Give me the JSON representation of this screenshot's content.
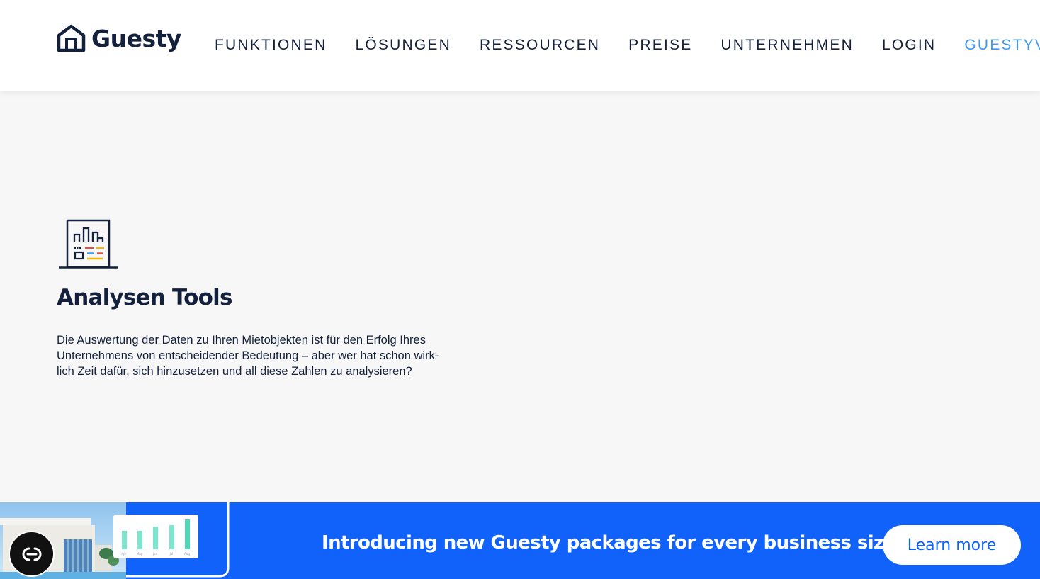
{
  "header": {
    "brand": "Guesty",
    "nav": [
      {
        "label": "FUNKTIONEN"
      },
      {
        "label": "LÖSUNGEN"
      },
      {
        "label": "RESSOURCEN"
      },
      {
        "label": "PREISE"
      },
      {
        "label": "UNTERNEHMEN"
      },
      {
        "label": "LOGIN"
      },
      {
        "label": "GUESTYVAL",
        "accent": "#3f99f1"
      }
    ]
  },
  "feature": {
    "icon": "analytics-dashboard-icon",
    "title": "Analysen Tools",
    "description_lines": [
      "Die Auswertung der Daten zu Ihren Mietobjekten ist für den Erfolg Ihres",
      "Unternehmens von entscheidender Bedeutung – aber wer hat schon wirk-",
      "lich Zeit dafür, sich hinzusetzen und all diese Zahlen zu analysieren?"
    ]
  },
  "banner": {
    "text": "Introducing new Guesty packages for every business size!",
    "button_label": "Learn more",
    "background": "#1062fb",
    "chart_months": [
      "Apr",
      "May",
      "Jun",
      "Jul",
      "Aug"
    ]
  },
  "accessibility_button": {
    "icon": "accessibility-toggle-icon"
  },
  "colors": {
    "navy": "#14213d",
    "accent": "#3f99f1",
    "banner_blue": "#1062fb",
    "page_bg": "#f7f7f7"
  }
}
